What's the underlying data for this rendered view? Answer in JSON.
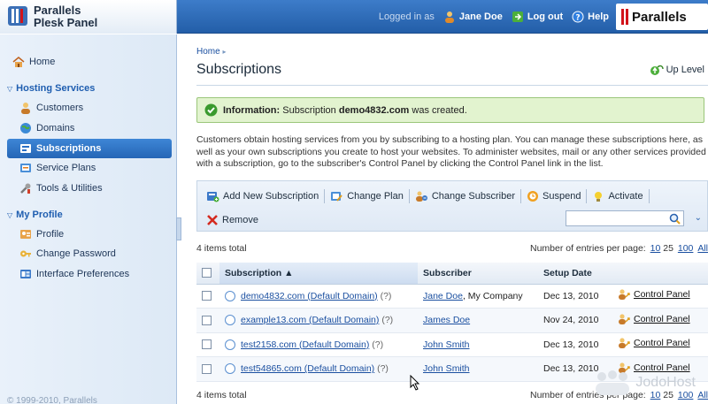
{
  "header": {
    "brand_line1": "Parallels",
    "brand_line2": "Plesk Panel",
    "logged_in_as": "Logged in as",
    "user_name": "Jane Doe",
    "logout_label": "Log out",
    "help_label": "Help",
    "logo_text": "Parallels"
  },
  "sidebar": {
    "home": "Home",
    "hosting_section": "Hosting Services",
    "customers": "Customers",
    "domains": "Domains",
    "subscriptions": "Subscriptions",
    "service_plans": "Service Plans",
    "tools": "Tools & Utilities",
    "profile_section": "My Profile",
    "profile": "Profile",
    "change_password": "Change Password",
    "interface_prefs": "Interface Preferences",
    "copyright": "© 1999-2010, Parallels"
  },
  "main": {
    "breadcrumb": "Home",
    "title": "Subscriptions",
    "up_level": "Up Level",
    "info_label": "Information:",
    "info_pre": "Subscription",
    "info_domain": "demo4832.com",
    "info_post": "was created.",
    "description": "Customers obtain hosting services from you by subscribing to a hosting plan. You can manage these subscriptions here, as well as your own subscriptions you create to host your websites. To administer websites, mail or any other services provided with a subscription, go to the subscriber's Control Panel by clicking the Control Panel link in the list.",
    "toolbar": {
      "add": "Add New Subscription",
      "change_plan": "Change Plan",
      "change_subscriber": "Change Subscriber",
      "suspend": "Suspend",
      "activate": "Activate",
      "remove": "Remove",
      "search_value": ""
    },
    "items_total": "4 items total",
    "per_page_label": "Number of entries per page:",
    "per_page_10": "10",
    "per_page_25": "25",
    "per_page_100": "100",
    "per_page_all": "All",
    "columns": {
      "subscription": "Subscription ▲",
      "subscriber": "Subscriber",
      "setup_date": "Setup Date"
    },
    "rows": [
      {
        "name": "demo4832.com (Default Domain)",
        "q": "(?)",
        "subscriber": "Jane Doe",
        "subscriber_extra": ", My Company",
        "date": "Dec 13, 2010",
        "cp": "Control Panel"
      },
      {
        "name": "example13.com (Default Domain)",
        "q": "(?)",
        "subscriber": "James Doe",
        "subscriber_extra": "",
        "date": "Nov 24, 2010",
        "cp": "Control Panel"
      },
      {
        "name": "test2158.com (Default Domain)",
        "q": "(?)",
        "subscriber": "John Smith",
        "subscriber_extra": "",
        "date": "Dec 13, 2010",
        "cp": "Control Panel"
      },
      {
        "name": "test54865.com (Default Domain)",
        "q": "(?)",
        "subscriber": "John Smith",
        "subscriber_extra": "",
        "date": "Dec 13, 2010",
        "cp": "Control Panel"
      }
    ],
    "watermark": "JodoHost"
  }
}
